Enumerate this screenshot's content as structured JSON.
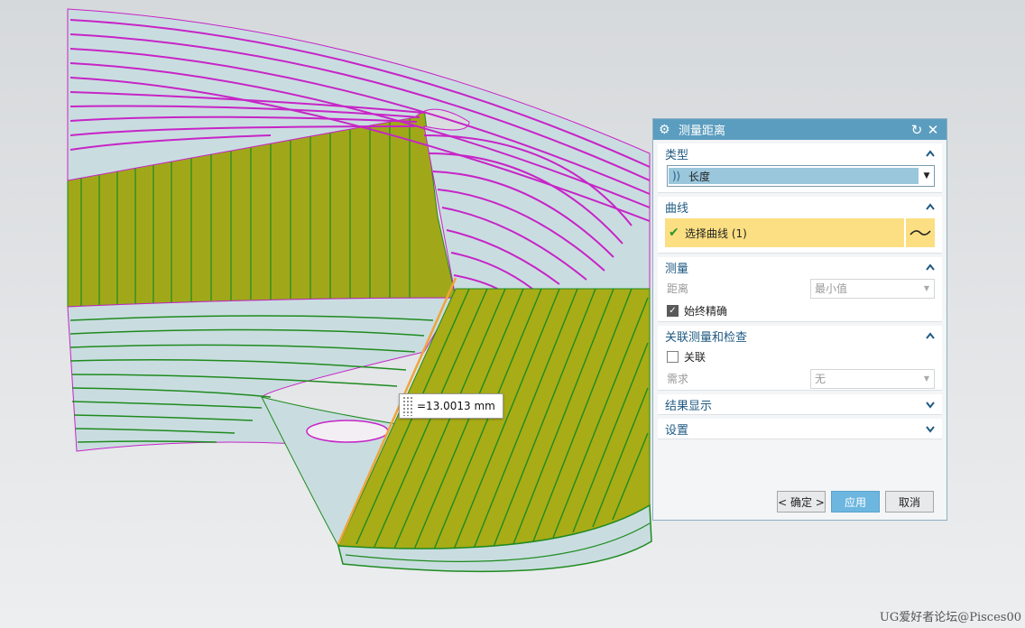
{
  "viewport": {
    "measurement_value": "=13.0013 mm"
  },
  "dialog": {
    "title": "测量距离",
    "type_section": {
      "label": "类型",
      "selected": "长度"
    },
    "curve_section": {
      "label": "曲线",
      "select_label": "选择曲线 (1)"
    },
    "measure_section": {
      "label": "测量",
      "distance_label": "距离",
      "distance_value": "最小值",
      "always_accurate_label": "始终精确",
      "always_accurate_checked": true
    },
    "assoc_section": {
      "label": "关联测量和检查",
      "assoc_label": "关联",
      "assoc_checked": false,
      "requirement_label": "需求",
      "requirement_value": "无"
    },
    "result_section": {
      "label": "结果显示"
    },
    "settings_section": {
      "label": "设置"
    },
    "buttons": {
      "ok": "< 确定 >",
      "apply": "应用",
      "cancel": "取消"
    }
  },
  "watermark": "UG爱好者论坛@Pisces00",
  "colors": {
    "title_bar": "#5b9dbf",
    "section_header": "#1f5a82",
    "selection_highlight": "#fbdf82",
    "wall_yellow": "#a8ac16",
    "surface_blue": "#c9dde0",
    "magenta_curve": "#c724c7",
    "green_curve": "#1f8a1f",
    "measured_edge": "#f0a43a"
  }
}
